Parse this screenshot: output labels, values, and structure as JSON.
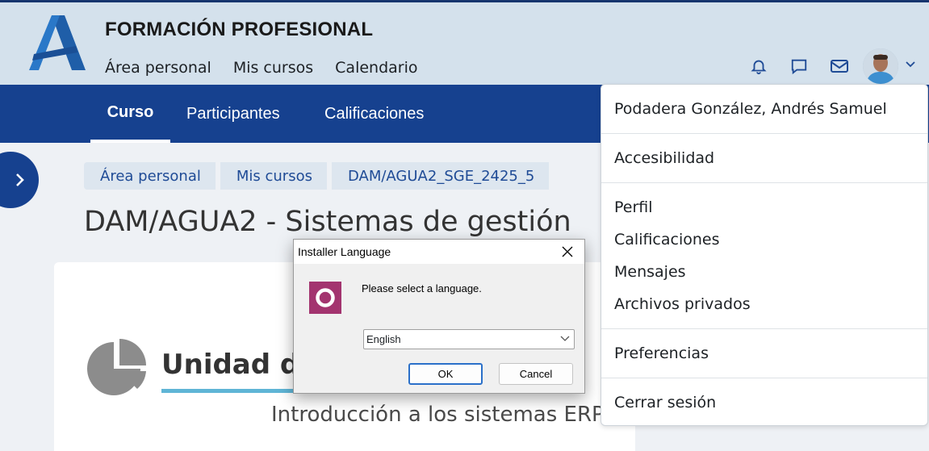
{
  "header": {
    "site_title": "FORMACIÓN PROFESIONAL",
    "nav": [
      "Área personal",
      "Mis cursos",
      "Calendario"
    ]
  },
  "course_nav": {
    "tabs": [
      "Curso",
      "Participantes",
      "Calificaciones"
    ],
    "active": "Curso"
  },
  "breadcrumb": [
    "Área personal",
    "Mis cursos",
    "DAM/AGUA2_SGE_2425_5"
  ],
  "page_title": "DAM/AGUA2 - Sistemas de gestión",
  "section": {
    "title": "Unidad de",
    "subtitle": "Introducción a los sistemas ERP"
  },
  "user_menu": {
    "user_name": "Podadera González, Andrés Samuel",
    "accessibility": "Accesibilidad",
    "profile": "Perfil",
    "grades": "Calificaciones",
    "messages": "Mensajes",
    "private_files": "Archivos privados",
    "preferences": "Preferencias",
    "logout": "Cerrar sesión"
  },
  "dialog": {
    "title": "Installer Language",
    "message": "Please select a language.",
    "selected_language": "English",
    "ok_label": "OK",
    "cancel_label": "Cancel"
  },
  "colors": {
    "header_bg": "#d4e1ec",
    "nav_bg": "#16418f",
    "dialog_icon": "#a3346f",
    "underline": "#5fb5d6"
  }
}
